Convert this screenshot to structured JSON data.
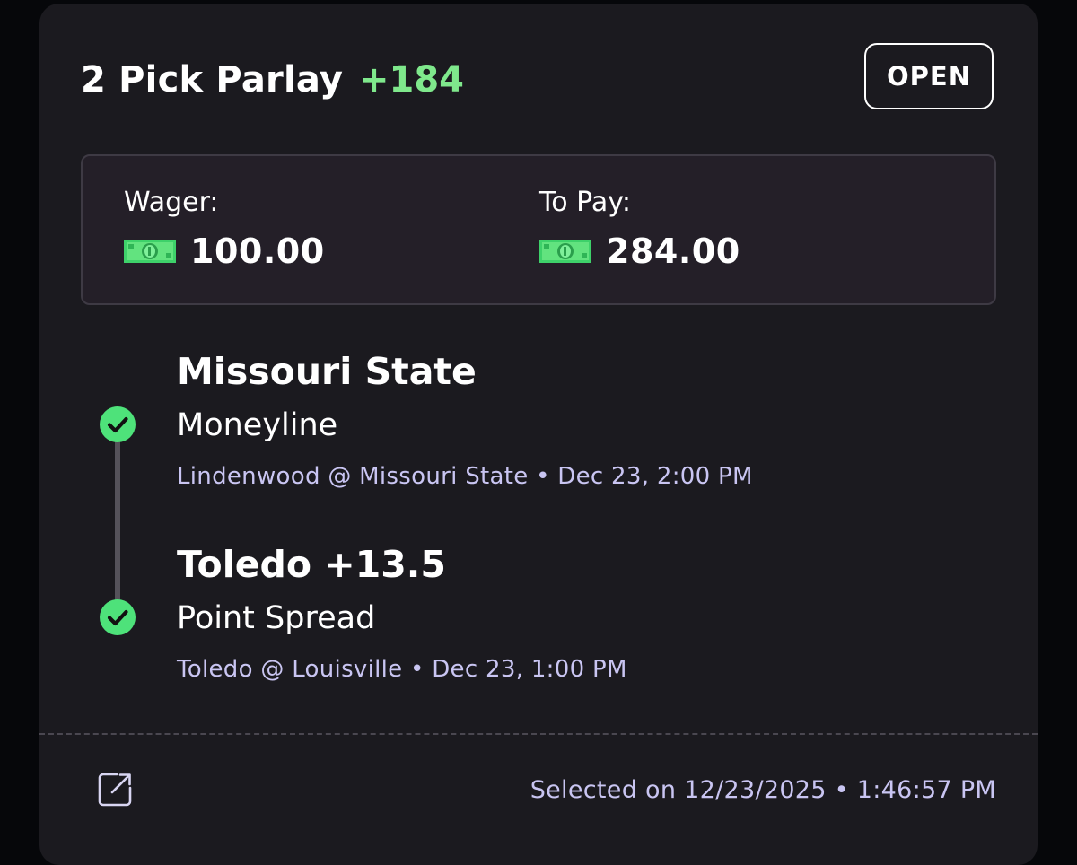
{
  "header": {
    "title": "2 Pick Parlay",
    "odds": "+184",
    "status": "OPEN"
  },
  "wager_box": {
    "wager_label": "Wager:",
    "wager_amount": "100.00",
    "to_pay_label": "To Pay:",
    "to_pay_amount": "284.00",
    "currency_icon": "cash-icon"
  },
  "legs": [
    {
      "selection": "Missouri State",
      "market": "Moneyline",
      "game": "Lindenwood @ Missouri State • Dec 23, 2:00 PM",
      "status_icon": "check-circle-icon"
    },
    {
      "selection": "Toledo +13.5",
      "market": "Point Spread",
      "game": "Toledo @ Louisville • Dec 23, 1:00 PM",
      "status_icon": "check-circle-icon"
    }
  ],
  "footer": {
    "share_icon": "share-icon",
    "selected_on": "Selected on 12/23/2025 • 1:46:57 PM"
  },
  "colors": {
    "background": "#06070a",
    "card": "#1b1a1f",
    "odds_green": "#7fe88c",
    "check_green": "#4ee27a",
    "subtext": "#c9c5f2"
  }
}
